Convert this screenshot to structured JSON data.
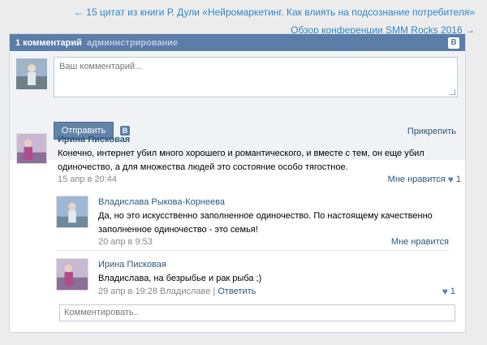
{
  "nav": {
    "prev": "← 15 цитат из книги Р. Дули «Нейромаркетинг. Как влиять на подсознание потребителя»",
    "next": "Обзор конференции SMM Rocks 2016 →"
  },
  "header": {
    "count": "1 комментарий",
    "admin": "администрирование",
    "logo": "B"
  },
  "compose": {
    "placeholder": "Ваш комментарий...",
    "send": "Отправить",
    "vk": "B",
    "attach": "Прикрепить"
  },
  "comments": [
    {
      "author": "Ирина Писковая",
      "text": "Конечно, интернет убил много хорошего и романтического, и вместе с тем, он еще убил одиночество, а для множества людей это состояние особо тягостное.",
      "date": "15 апр в 20:44",
      "like": "Мне нравится",
      "likes": "1"
    },
    {
      "author": "Владислава Рыкова-Корнеева",
      "text": "Да, но это искусственно заполненное одиночество. По настоящему качественно заполненное одиночество - это семья!",
      "date": "20 апр в 9:53",
      "like": "Мне нравится"
    },
    {
      "author": "Ирина Писковая",
      "text": "Владислава, на безрыбье и рак рыба ;)",
      "date": "29 апр в 19:28 Владиславе",
      "sep": "|",
      "reply": "Ответить",
      "likes": "1"
    }
  ],
  "reply_box": {
    "placeholder": "Комментировать.."
  },
  "colors": {
    "header_bg": "#5b7da8",
    "link": "#2b587a",
    "nav_link": "#2e87c8",
    "button": "#6383a8"
  }
}
